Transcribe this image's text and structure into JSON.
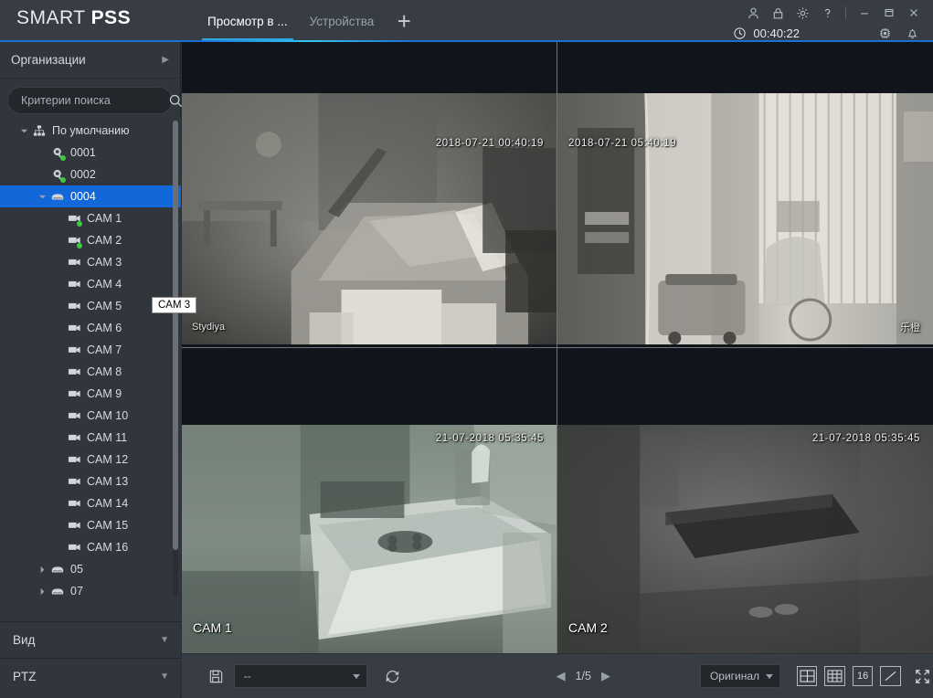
{
  "app": {
    "brand_smart": "SMART ",
    "brand_pss": "PSS"
  },
  "titlebar": {
    "tabs": [
      {
        "label": "Просмотр в ...",
        "active": true
      },
      {
        "label": "Устройства",
        "active": false
      }
    ],
    "add_tab_label": "+",
    "icons": [
      "user-icon",
      "lock-icon",
      "gear-icon",
      "help-icon"
    ],
    "window_controls": [
      "minimize-icon",
      "maximize-icon",
      "close-icon"
    ],
    "clock": "00:40:22",
    "status_icons": [
      "cpu-icon",
      "bell-icon"
    ]
  },
  "sidebar": {
    "organizations_label": "Организации",
    "search": {
      "value": "",
      "placeholder": "Критерии поиска"
    },
    "tree": [
      {
        "label": "По умолчанию",
        "level": 0,
        "icon": "org-tree-icon",
        "expanded": true,
        "selected": false,
        "status": "none"
      },
      {
        "label": "0001",
        "level": 1,
        "icon": "dome-camera-icon",
        "expanded": null,
        "selected": false,
        "status": "online"
      },
      {
        "label": "0002",
        "level": 1,
        "icon": "dome-camera-icon",
        "expanded": null,
        "selected": false,
        "status": "online"
      },
      {
        "label": "0004",
        "level": 1,
        "icon": "nvr-icon",
        "expanded": true,
        "selected": true,
        "status": "none"
      },
      {
        "label": "CAM 1",
        "level": 2,
        "icon": "camera-icon",
        "expanded": null,
        "selected": false,
        "status": "online"
      },
      {
        "label": "CAM 2",
        "level": 2,
        "icon": "camera-icon",
        "expanded": null,
        "selected": false,
        "status": "online"
      },
      {
        "label": "CAM 3",
        "level": 2,
        "icon": "camera-icon",
        "expanded": null,
        "selected": false,
        "status": "offline"
      },
      {
        "label": "CAM 4",
        "level": 2,
        "icon": "camera-icon",
        "expanded": null,
        "selected": false,
        "status": "offline"
      },
      {
        "label": "CAM 5",
        "level": 2,
        "icon": "camera-icon",
        "expanded": null,
        "selected": false,
        "status": "offline"
      },
      {
        "label": "CAM 6",
        "level": 2,
        "icon": "camera-icon",
        "expanded": null,
        "selected": false,
        "status": "offline"
      },
      {
        "label": "CAM 7",
        "level": 2,
        "icon": "camera-icon",
        "expanded": null,
        "selected": false,
        "status": "offline"
      },
      {
        "label": "CAM 8",
        "level": 2,
        "icon": "camera-icon",
        "expanded": null,
        "selected": false,
        "status": "offline"
      },
      {
        "label": "CAM 9",
        "level": 2,
        "icon": "camera-icon",
        "expanded": null,
        "selected": false,
        "status": "offline"
      },
      {
        "label": "CAM 10",
        "level": 2,
        "icon": "camera-icon",
        "expanded": null,
        "selected": false,
        "status": "offline"
      },
      {
        "label": "CAM 11",
        "level": 2,
        "icon": "camera-icon",
        "expanded": null,
        "selected": false,
        "status": "offline"
      },
      {
        "label": "CAM 12",
        "level": 2,
        "icon": "camera-icon",
        "expanded": null,
        "selected": false,
        "status": "offline"
      },
      {
        "label": "CAM 13",
        "level": 2,
        "icon": "camera-icon",
        "expanded": null,
        "selected": false,
        "status": "offline"
      },
      {
        "label": "CAM 14",
        "level": 2,
        "icon": "camera-icon",
        "expanded": null,
        "selected": false,
        "status": "offline"
      },
      {
        "label": "CAM 15",
        "level": 2,
        "icon": "camera-icon",
        "expanded": null,
        "selected": false,
        "status": "offline"
      },
      {
        "label": "CAM 16",
        "level": 2,
        "icon": "camera-icon",
        "expanded": null,
        "selected": false,
        "status": "offline"
      },
      {
        "label": "05",
        "level": 1,
        "icon": "nvr-icon",
        "expanded": false,
        "selected": false,
        "status": "none"
      },
      {
        "label": "07",
        "level": 1,
        "icon": "nvr-icon",
        "expanded": false,
        "selected": false,
        "status": "none"
      }
    ],
    "sections": [
      {
        "label": "Вид",
        "collapsed": true
      },
      {
        "label": "PTZ",
        "collapsed": true
      }
    ]
  },
  "tooltip": {
    "text": "CAM 3"
  },
  "video": {
    "panes": [
      {
        "name": "Stydiya",
        "name_pos": "bottom-left",
        "name_size": "small",
        "timestamp": "2018-07-21 00:40:19",
        "stamp_pos": "top-right"
      },
      {
        "name": "乐橙",
        "name_pos": "bottom-right",
        "name_size": "small",
        "timestamp": "2018-07-21 05:40:19",
        "stamp_pos": "top-left"
      },
      {
        "name": "CAM 1",
        "name_pos": "bottom-left",
        "name_size": "large",
        "timestamp": "21-07-2018 05:35:45",
        "stamp_pos": "top-right"
      },
      {
        "name": "CAM 2",
        "name_pos": "bottom-left",
        "name_size": "large",
        "timestamp": "21-07-2018 05:35:45",
        "stamp_pos": "top-right"
      }
    ]
  },
  "bottombar": {
    "save_view_icon": "save-view-icon",
    "tour_select": {
      "value": "--",
      "options": [
        "--"
      ]
    },
    "tour_toggle_icon": "tour-refresh-icon",
    "prev_label": "◀",
    "page_label": "1/5",
    "next_label": "▶",
    "stream_select": {
      "value": "Оригинал",
      "options": [
        "Оригинал"
      ]
    },
    "layout_buttons": [
      {
        "name": "split-4",
        "label": "4"
      },
      {
        "name": "split-9",
        "label": "9"
      },
      {
        "name": "split-16",
        "label": "16"
      },
      {
        "name": "split-custom",
        "label": ""
      }
    ],
    "fullscreen_icon": "fullscreen-icon"
  },
  "colors": {
    "accent_blue": "#1268d8",
    "tab_underline": "#2fa8e0",
    "titlebar_bg": "#383d45",
    "sidebar_bg": "#31353c",
    "stage_bg": "#11141a",
    "status_online": "#3ecc3e"
  }
}
